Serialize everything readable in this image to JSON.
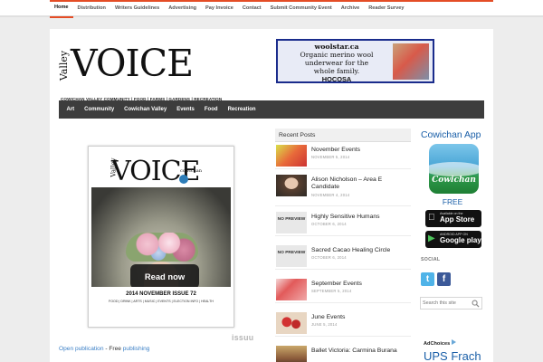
{
  "topnav": {
    "items": [
      "Home",
      "Distribution",
      "Writers Guidelines",
      "Advertising",
      "Pay Invoice",
      "Contact",
      "Submit Community Event",
      "Archive",
      "Reader Survey"
    ],
    "active": "Home"
  },
  "logo": {
    "valley": "Valley",
    "voice": "VOICE",
    "tagline": "COWICHAN VALLEY COMMUNITY | FOOD | FARMS | GARDENS | RECREATION"
  },
  "banner_ad": {
    "title": "woolstar.ca",
    "line1": "Organic merino wool",
    "line2": "underwear for the",
    "line3": "whole family.",
    "brand": "HOCOSA"
  },
  "mainnav": [
    "Art",
    "Community",
    "Cowichan Valley",
    "Events",
    "Food",
    "Recreation"
  ],
  "magazine": {
    "valley": "Valley",
    "title": "VOICE",
    "cowichan": "cowichan",
    "read_now": "Read now",
    "issue": "2014 NOVEMBER ISSUE 72",
    "subline": "FOOD | DRINK | ARTS | MUSIC | EVENTS | ELECTION INFO | HEALTH",
    "issuu": "issuu"
  },
  "publication": {
    "link1": "Open publication",
    "sep": " - Free ",
    "link2": "publishing"
  },
  "recent_posts": {
    "heading": "Recent Posts",
    "no_preview": "NO PREVIEW",
    "items": [
      {
        "title": "November Events",
        "date": "NOVEMBER 5, 2014",
        "thumb": "image"
      },
      {
        "title": "Alison Nicholson – Area E Candidate",
        "date": "NOVEMBER 4, 2014",
        "thumb": "image"
      },
      {
        "title": "Highly Sensitive Humans",
        "date": "OCTOBER 6, 2014",
        "thumb": "none"
      },
      {
        "title": "Sacred Cacao Healing Circle",
        "date": "OCTOBER 6, 2014",
        "thumb": "none"
      },
      {
        "title": "September Events",
        "date": "SEPTEMBER 5, 2014",
        "thumb": "image"
      },
      {
        "title": "June Events",
        "date": "JUNE 5, 2014",
        "thumb": "image"
      },
      {
        "title": "Ballet Victoria: Carmina Burana",
        "date": "",
        "thumb": "image"
      }
    ]
  },
  "sidebar": {
    "app_title": "Cowichan App",
    "app_icon_text": "Cowichan",
    "free": "FREE",
    "appstore_small": "Available on the",
    "appstore_big": "App Store",
    "googleplay_small": "ANDROID APP ON",
    "googleplay_big": "Google play",
    "social_label": "SOCIAL",
    "twitter_glyph": "t",
    "facebook_glyph": "f",
    "search_placeholder": "Search this site",
    "adchoices": "AdChoices",
    "ups": "UPS Frach"
  },
  "colors": {
    "accent": "#e44d26",
    "nav_bg": "#3d3d3d",
    "link_blue": "#1a5fa8",
    "banner_border": "#1a2c8c"
  }
}
